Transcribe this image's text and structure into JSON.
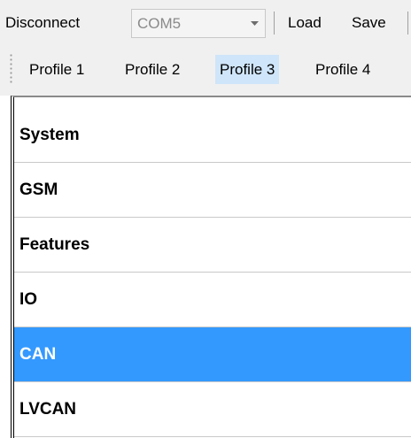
{
  "toolbar": {
    "disconnect_label": "Disconnect",
    "port_value": "COM5",
    "load_label": "Load",
    "save_label": "Save"
  },
  "profiles": {
    "tabs": [
      {
        "label": "Profile 1",
        "selected": false
      },
      {
        "label": "Profile 2",
        "selected": false
      },
      {
        "label": "Profile 3",
        "selected": true
      },
      {
        "label": "Profile 4",
        "selected": false
      }
    ]
  },
  "nav": {
    "items": [
      {
        "label": "System",
        "selected": false
      },
      {
        "label": "GSM",
        "selected": false
      },
      {
        "label": "Features",
        "selected": false
      },
      {
        "label": "IO",
        "selected": false
      },
      {
        "label": "CAN",
        "selected": true
      },
      {
        "label": "LVCAN",
        "selected": false
      }
    ]
  },
  "colors": {
    "selected_nav_bg": "#3399ff",
    "selected_tab_bg": "#cfe5f9"
  }
}
